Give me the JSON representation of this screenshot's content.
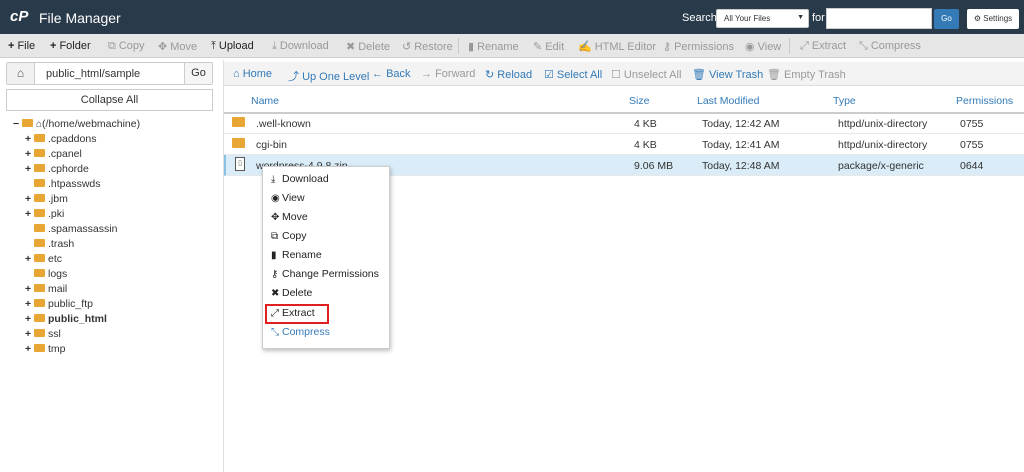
{
  "app": {
    "logo": "cP",
    "title": "File Manager"
  },
  "search": {
    "label": "Search",
    "scope_value": "All Your Files",
    "for_label": "for",
    "query_value": "",
    "go_label": "Go",
    "settings_label": "Settings"
  },
  "toolbar": {
    "file": "File",
    "folder": "Folder",
    "copy": "Copy",
    "move": "Move",
    "upload": "Upload",
    "download": "Download",
    "delete": "Delete",
    "restore": "Restore",
    "rename": "Rename",
    "edit": "Edit",
    "html_editor": "HTML Editor",
    "permissions": "Permissions",
    "view": "View",
    "extract": "Extract",
    "compress": "Compress"
  },
  "left": {
    "path_value": "public_html/sample",
    "go_label": "Go",
    "collapse_all": "Collapse All",
    "tree": [
      {
        "label": "(/home/webmachine)",
        "toggle": "−"
      },
      {
        "label": ".cpaddons",
        "toggle": "+"
      },
      {
        "label": ".cpanel",
        "toggle": "+"
      },
      {
        "label": ".cphorde",
        "toggle": "+"
      },
      {
        "label": ".htpasswds",
        "toggle": ""
      },
      {
        "label": ".jbm",
        "toggle": "+"
      },
      {
        "label": ".pki",
        "toggle": "+"
      },
      {
        "label": ".spamassassin",
        "toggle": ""
      },
      {
        "label": ".trash",
        "toggle": ""
      },
      {
        "label": "etc",
        "toggle": "+"
      },
      {
        "label": "logs",
        "toggle": ""
      },
      {
        "label": "mail",
        "toggle": "+"
      },
      {
        "label": "public_ftp",
        "toggle": "+"
      },
      {
        "label": "public_html",
        "toggle": "+"
      },
      {
        "label": "ssl",
        "toggle": "+"
      },
      {
        "label": "tmp",
        "toggle": "+"
      }
    ]
  },
  "actions": {
    "home": "Home",
    "up_one_level": "Up One Level",
    "back": "Back",
    "forward": "Forward",
    "reload": "Reload",
    "select_all": "Select All",
    "unselect_all": "Unselect All",
    "view_trash": "View Trash",
    "empty_trash": "Empty Trash"
  },
  "table": {
    "headers": {
      "name": "Name",
      "size": "Size",
      "modified": "Last Modified",
      "type": "Type",
      "permissions": "Permissions"
    },
    "rows": [
      {
        "name": ".well-known",
        "size": "4 KB",
        "modified": "Today, 12:42 AM",
        "type": "httpd/unix-directory",
        "perms": "0755"
      },
      {
        "name": "cgi-bin",
        "size": "4 KB",
        "modified": "Today, 12:41 AM",
        "type": "httpd/unix-directory",
        "perms": "0755"
      },
      {
        "name": "wordpress-4.9.8.zip",
        "size": "9.06 MB",
        "modified": "Today, 12:48 AM",
        "type": "package/x-generic",
        "perms": "0644"
      }
    ]
  },
  "context_menu": {
    "download": "Download",
    "view": "View",
    "move": "Move",
    "copy": "Copy",
    "rename": "Rename",
    "change_permissions": "Change Permissions",
    "delete": "Delete",
    "extract": "Extract",
    "compress": "Compress"
  },
  "colors": {
    "topbar": "#293a4a",
    "accent": "#337ab7",
    "folder": "#e8a634",
    "highlight": "#e02020",
    "selected_row": "#d9ecf8"
  }
}
